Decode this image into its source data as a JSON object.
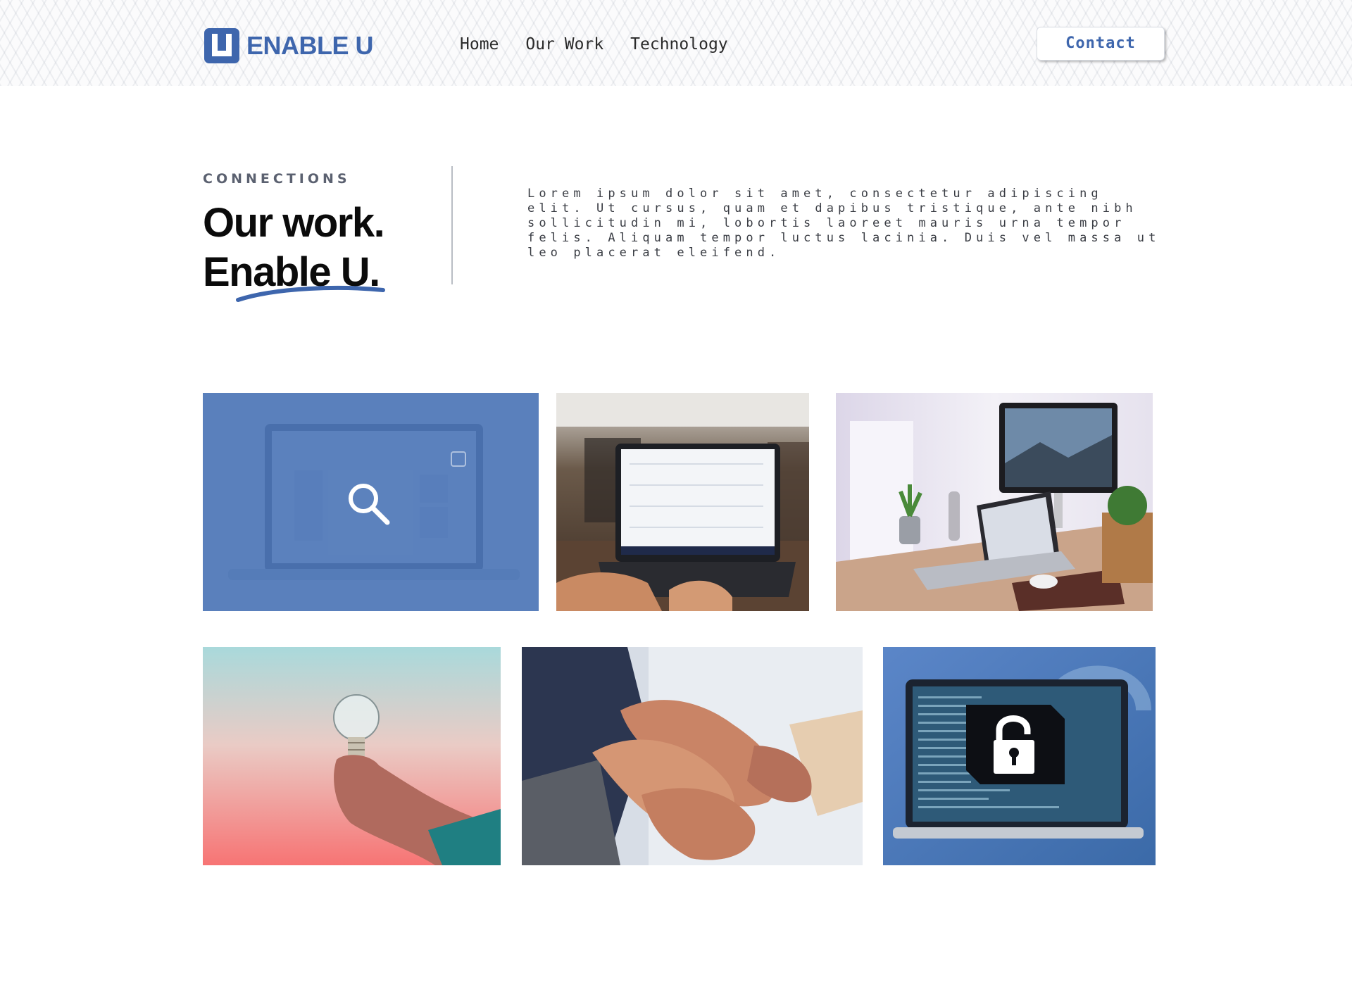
{
  "header": {
    "logo_text": "ENABLE U",
    "logo_mark_letter": "U",
    "nav": [
      "Home",
      "Our Work",
      "Technology"
    ],
    "contact_label": "Contact"
  },
  "intro": {
    "eyebrow": "CONNECTIONS",
    "heading_line1": "Our work.",
    "heading_line2": "Enable U.",
    "body": "Lorem ipsum dolor sit amet, consectetur adipiscing elit. Ut cursus, quam et dapibus tristique, ante nibh sollicitudin mi, lobortis laoreet mauris urna tempor felis. Aliquam tempor luctus lacinia. Duis vel massa ut leo placerat eleifend."
  },
  "gallery": {
    "tiles": [
      {
        "subject": "laptop-search-overlay",
        "icon": "magnifier-icon"
      },
      {
        "subject": "laptop-dashboard-photo"
      },
      {
        "subject": "workspace-desk-photo"
      },
      {
        "subject": "lightbulb-hand-photo"
      },
      {
        "subject": "joined-hands-photo"
      },
      {
        "subject": "laptop-security-photo",
        "icon": "padlock-icon"
      }
    ]
  },
  "colors": {
    "brand": "#3e66ad",
    "heading": "#0b0b0b",
    "text": "#3a3d44",
    "overlay": "#4a74b6"
  }
}
